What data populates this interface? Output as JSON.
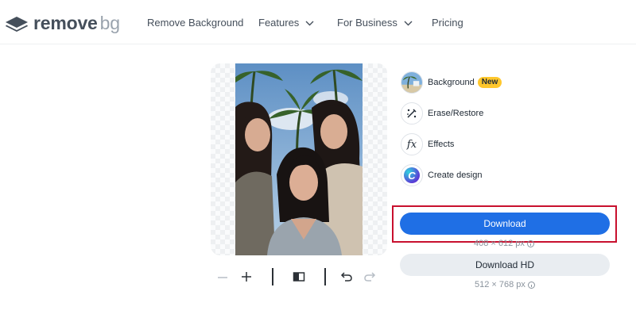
{
  "brand": {
    "name": "remove",
    "name_suffix": "bg"
  },
  "nav": {
    "remove_background": "Remove Background",
    "features": "Features",
    "for_business": "For Business",
    "pricing": "Pricing"
  },
  "sidebar": {
    "background_label": "Background",
    "new_badge": "New",
    "erase_restore_label": "Erase/Restore",
    "effects_label": "Effects",
    "effects_glyph": "fx",
    "create_design_label": "Create design",
    "create_design_glyph": "C"
  },
  "download": {
    "label": "Download",
    "preview_size": "408 × 612 px",
    "hd_label": "Download HD",
    "hd_size": "512 × 768 px"
  },
  "icons": {
    "logo": "layers-logo-icon",
    "features_dropdown": "chevron-down-icon",
    "business_dropdown": "chevron-down-icon",
    "zoom_out": "minus-icon",
    "zoom_in": "plus-icon",
    "compare": "compare-icon",
    "undo": "undo-icon",
    "redo": "redo-icon",
    "info": "info-icon",
    "erase_restore": "brush-icon"
  },
  "colors": {
    "primary_button": "#1f6fe5",
    "highlight_border": "#c8102e",
    "new_badge": "#ffc72c",
    "secondary_button": "#e9edf1"
  }
}
